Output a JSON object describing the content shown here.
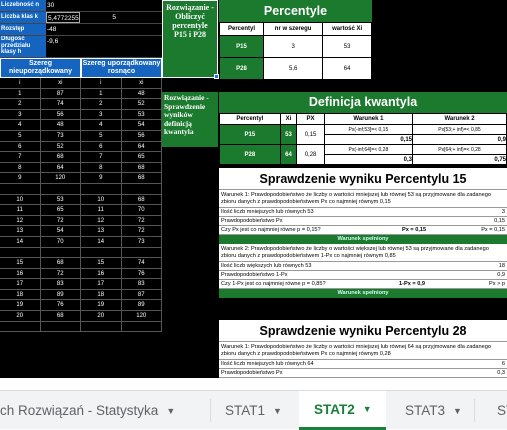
{
  "stats": [
    {
      "label": "Liczebność n",
      "value": "30",
      "extra": ""
    },
    {
      "label": "Liczba klas k",
      "value": "5,4772255",
      "extra": "5"
    },
    {
      "label": "Rozstęp",
      "value": "-48",
      "extra": ""
    },
    {
      "label": "Długość przedziału klasy h",
      "value": "-9,6",
      "extra": ""
    }
  ],
  "series_headers": {
    "unordered": "Szereg nieuporządkowany",
    "ordered": "Szereg uporządkowany rosnąco"
  },
  "series_cols": [
    "i",
    "xi",
    "i",
    "xi"
  ],
  "series_rows": [
    [
      "1",
      "87",
      "1",
      "48"
    ],
    [
      "2",
      "74",
      "2",
      "52"
    ],
    [
      "3",
      "56",
      "3",
      "53"
    ],
    [
      "4",
      "48",
      "4",
      "54"
    ],
    [
      "5",
      "73",
      "5",
      "56"
    ],
    [
      "6",
      "52",
      "6",
      "64"
    ],
    [
      "7",
      "68",
      "7",
      "65"
    ],
    [
      "8",
      "64",
      "8",
      "68"
    ],
    [
      "9",
      "120",
      "9",
      "68"
    ],
    [
      "",
      "",
      "",
      ""
    ],
    [
      "10",
      "53",
      "10",
      "68"
    ],
    [
      "11",
      "65",
      "11",
      "70"
    ],
    [
      "12",
      "72",
      "12",
      "72"
    ],
    [
      "13",
      "54",
      "13",
      "72"
    ],
    [
      "14",
      "70",
      "14",
      "73"
    ],
    [
      "",
      "",
      "",
      ""
    ],
    [
      "15",
      "68",
      "15",
      "74"
    ],
    [
      "16",
      "72",
      "16",
      "76"
    ],
    [
      "17",
      "83",
      "17",
      "83"
    ],
    [
      "18",
      "89",
      "18",
      "87"
    ],
    [
      "19",
      "76",
      "19",
      "89"
    ],
    [
      "20",
      "68",
      "20",
      "120"
    ],
    [
      "",
      "",
      "",
      ""
    ]
  ],
  "solution_box": "Rozwiązanie - Obliczyć percentyle P15 i P28",
  "verify_box": "Rozwiązanie - Sprawdzenie wyników definicją kwantyla",
  "percentile": {
    "title": "Percentyle",
    "cols": [
      "Percentyl",
      "nr w szeregu",
      "wartość Xi"
    ],
    "rows": [
      [
        "P15",
        "3",
        "53"
      ],
      [
        "P28",
        "5,6",
        "64"
      ]
    ]
  },
  "kwantyl": {
    "title": "Definicja kwantyla",
    "cols": [
      "Percentyl",
      "Xi",
      "PX",
      "Warunek 1",
      "Warunek 2"
    ],
    "rows": [
      {
        "p": "P15",
        "xi": "53",
        "px": "0,15",
        "w1a": "Px(-inf;53]=< 0,15",
        "w1b": "0,15",
        "w2a": "Px[53;+ inf)=< 0,85",
        "w2b": "0,9"
      },
      {
        "p": "P28",
        "xi": "64",
        "px": "0,28",
        "w1a": "Px(-inf;64]=< 0,28",
        "w1b": "0,3",
        "w2a": "Px[64;+ inf)=< 0,28",
        "w2b": "0,75"
      }
    ]
  },
  "check15": {
    "title": "Sprawdzenie wyniku Percentylu 15",
    "w1_text": "Warunek 1:  Prawdopodobieństwo że liczby o wartości mniejszej lub równej 53 są przyjmowane dla zadanego zbioru danych  z prawdopodobieństwem Px co najmniej równym 0,15",
    "w1_lines": [
      [
        "Ilość liczb mniejszych lub równych 53",
        "3"
      ],
      [
        "Prawdopodobieństwo Px",
        "0,15"
      ],
      [
        "Czy Px jest co najmniej równe p = 0,15?",
        "Px = 0,15",
        "Px = 0,15"
      ]
    ],
    "w1_ok": "Warunek spełniony",
    "w2_text": "Warunek 2:  Prawdopodobieństwo że liczby o wartości większej lub równej 53 są przyjmowane dla zadanego zbioru danych  z prawdopodobieństwem 1-Px co najmniej równym 0,85",
    "w2_lines": [
      [
        "Ilość liczb większych lub równych 53",
        "18"
      ],
      [
        "Prawdopodobieństwo 1-Px",
        "0,9"
      ],
      [
        "Czy 1-Px jest co najmniej równe p = 0,85?",
        "1-Px = 0,9",
        "Px > p"
      ]
    ],
    "w2_ok": "Warunek spełniony"
  },
  "check28": {
    "title": "Sprawdzenie wyniku Percentylu 28",
    "w1_text": "Warunek 1:  Prawdopodobieństwo że liczby o wartości mniejszej lub równej 64 są przyjmowane dla zadanego zbioru danych  z prawdopodobieństwem Px co najmniej równym 0,28",
    "w1_lines": [
      [
        "Ilość liczb mniejszych lub równych 64",
        "6"
      ],
      [
        "Prawdopodobieństwo Px",
        "0,3"
      ]
    ]
  },
  "tabs": [
    {
      "label": "ch Rozwiązań - Statystyka",
      "active": false
    },
    {
      "label": "STAT1",
      "active": false
    },
    {
      "label": "STAT2",
      "active": true
    },
    {
      "label": "STAT3",
      "active": false
    },
    {
      "label": "ST",
      "active": false
    }
  ],
  "colors": {
    "green": "#1b7a2e",
    "blue": "#1565c0",
    "tab_active": "#188038"
  }
}
